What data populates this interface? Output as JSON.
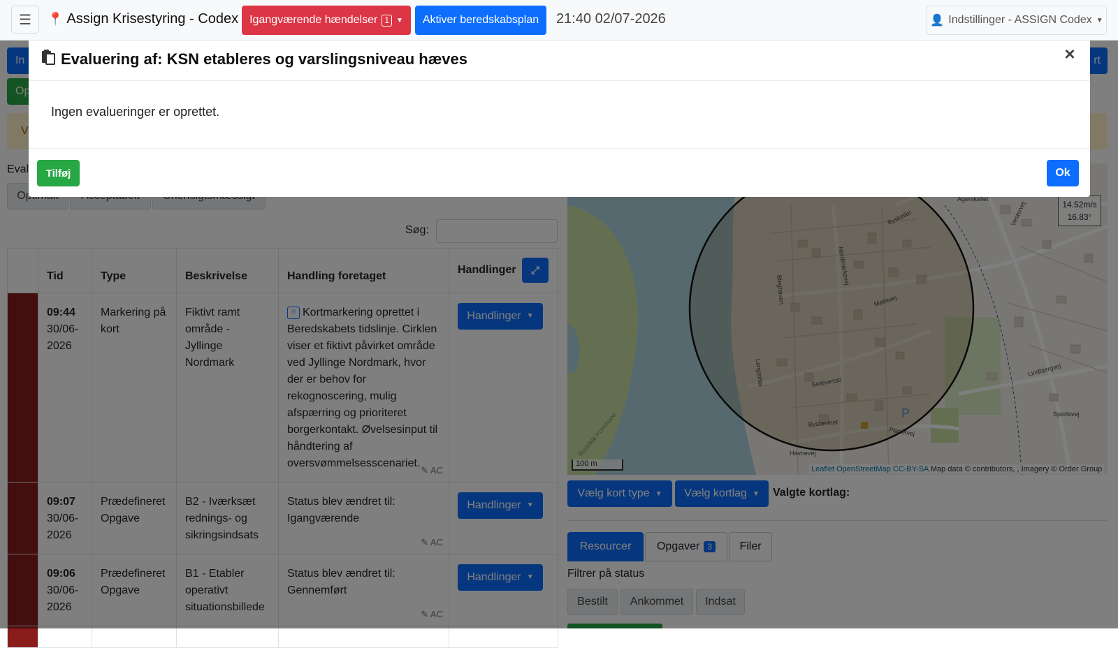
{
  "navbar": {
    "menu_icon": "hamburger-icon",
    "brand": "Assign Krisestyring - Codex",
    "events_button": "Igangværende hændelser",
    "events_count": "1",
    "plan_button": "Aktiver beredskabsplan",
    "datetime": "21:40 02/07-2026",
    "settings": "Indstillinger - ASSIGN Codex"
  },
  "background": {
    "btn_blue_left": "In",
    "btn_green_left": "Op",
    "btn_right": "rt",
    "alert_text": "V",
    "eval_label": "Eval",
    "segments": [
      "Optimalt",
      "Acceptabelt",
      "Uhensigtsmæssigt"
    ],
    "search_label": "Søg:"
  },
  "timeline": {
    "headers": [
      "",
      "Tid",
      "Type",
      "Beskrivelse",
      "Handling foretaget",
      "Handlinger"
    ],
    "action_label": "Handlinger",
    "rows": [
      {
        "time": "09:44",
        "date": "30/06-2026",
        "type": "Markering på kort",
        "description": "Fiktivt ramt område - Jyllinge Nordmark",
        "action": "Kortmarkering oprettet i Beredskabets tidslinje. Cirklen viser et fiktivt påvirket område ved Jyllinge Nordmark, hvor der er behov for rekognoscering, mulig afspærring og prioriteret borgerkontakt. Øvelsesinput til håndtering af oversvømmelsesscenariet.",
        "sig": "AC"
      },
      {
        "time": "09:07",
        "date": "30/06-2026",
        "type": "Prædefineret Opgave",
        "description": "B2 - Iværksæt rednings- og sikringsindsats",
        "action": "Status blev ændret til: Igangværende",
        "sig": "AC"
      },
      {
        "time": "09:06",
        "date": "30/06-2026",
        "type": "Prædefineret Opgave",
        "description": "B1 - Etabler operativt situationsbillede",
        "action": "Status blev ændret til: Gennemført",
        "sig": "AC"
      }
    ]
  },
  "map": {
    "wind_speed": "14.52m/s",
    "wind_dir": "16.83°",
    "scale": "100 m",
    "attribution_link1": "Leaflet",
    "attribution_link2": "OpenStreetMap",
    "attribution_link3": "CC-BY-SA",
    "attribution_rest": " Map data © contributors, , Imagery © Order Group",
    "streets": [
      "Agerskellet",
      "Byskellet",
      "Nordmarksvej",
      "Møllevej",
      "Bleghaven",
      "Snævertsti",
      "Bystævnet",
      "Langtoftet",
      "Planetvej",
      "Lindbjergvej",
      "Sportsvej",
      "Havnevej",
      "Vestervej",
      "Roskilde Kommune"
    ]
  },
  "map_controls": {
    "map_type_button": "Vælg kort type",
    "layer_button": "Vælg kortlag",
    "chosen_layers": "Valgte kortlag:"
  },
  "tabs": {
    "resources": "Resourcer",
    "tasks": "Opgaver",
    "tasks_count": "3",
    "files": "Filer"
  },
  "filter": {
    "label": "Filtrer på status",
    "chips": [
      "Bestilt",
      "Ankommet",
      "Indsat"
    ]
  },
  "modal": {
    "title": "Evaluering af: KSN etableres og varslingsniveau hæves",
    "title_icon": "clipboard-icon",
    "close": "×",
    "body": "Ingen evalueringer er oprettet.",
    "add_button": "Tilføj",
    "ok_button": "Ok"
  }
}
